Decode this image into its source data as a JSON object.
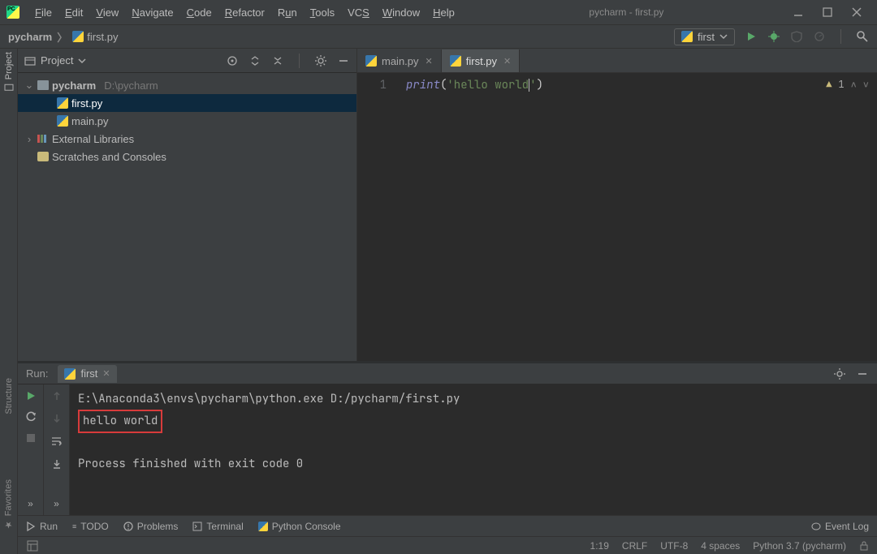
{
  "window": {
    "title_suffix": "pycharm - first.py"
  },
  "menu": [
    "File",
    "Edit",
    "View",
    "Navigate",
    "Code",
    "Refactor",
    "Run",
    "Tools",
    "VCS",
    "Window",
    "Help"
  ],
  "breadcrumbs": {
    "root": "pycharm",
    "file": "first.py"
  },
  "run_config": {
    "selected": "first"
  },
  "project_panel": {
    "title": "Project",
    "root": {
      "name": "pycharm",
      "path": "D:\\pycharm"
    },
    "files": [
      "first.py",
      "main.py"
    ],
    "external": "External Libraries",
    "scratches": "Scratches and Consoles"
  },
  "tabs": [
    {
      "label": "main.py",
      "active": false
    },
    {
      "label": "first.py",
      "active": true
    }
  ],
  "editor": {
    "line_no": "1",
    "code": {
      "fn": "print",
      "lpar": "(",
      "str1": "'hello world",
      "str2": "'",
      "rpar": ")"
    },
    "warning_count": "1"
  },
  "run": {
    "label": "Run:",
    "tab": "first",
    "lines": {
      "cmd": "E:\\Anaconda3\\envs\\pycharm\\python.exe D:/pycharm/first.py",
      "out": "hello world",
      "exit": "Process finished with exit code 0"
    }
  },
  "bottom_tools": {
    "run": "Run",
    "todo": "TODO",
    "problems": "Problems",
    "terminal": "Terminal",
    "pyconsole": "Python Console",
    "eventlog": "Event Log"
  },
  "status": {
    "pos": "1:19",
    "eol": "CRLF",
    "enc": "UTF-8",
    "indent": "4 spaces",
    "interp": "Python 3.7 (pycharm)"
  },
  "side_tools": {
    "project": "Project",
    "structure": "Structure",
    "favorites": "Favorites"
  }
}
